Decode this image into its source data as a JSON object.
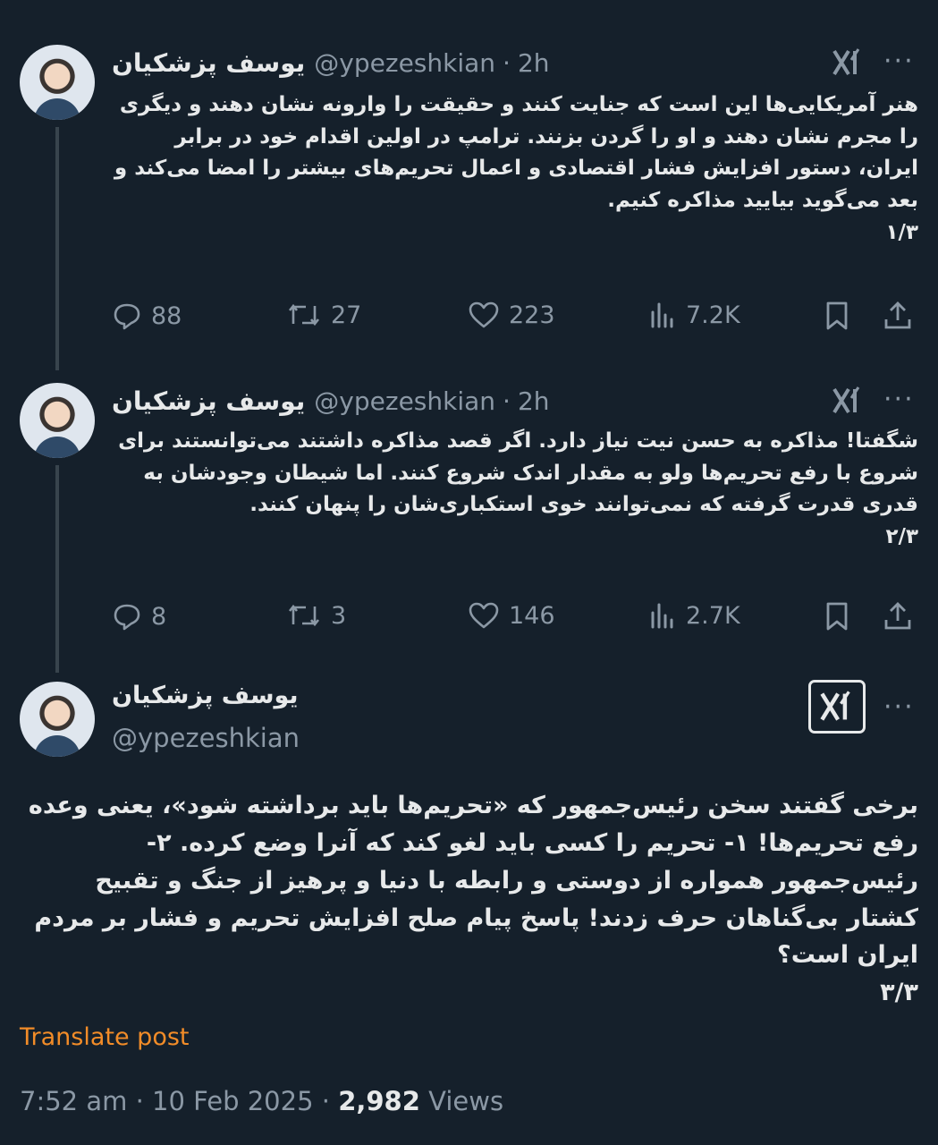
{
  "tweets": [
    {
      "name": "یوسف پزشکیان",
      "handle": "@ypezeshkian",
      "time": "2h",
      "text_lines": [
        "هنر آمریکایی‌ها این است که جنایت کنند و حقیقت  را وارونه نشان دهند و دیگری را مجرم نشان دهند و او را گردن بزنند. ترامپ در اولین اقدام خود در برابر ایران، دستور افزایش فشار اقتصادی و اعمال تحریم‌های بیشتر را امضا می‌کند و بعد می‌گوید بیایید مذاکره کنیم.",
        "۱/۳"
      ],
      "replies": "88",
      "reposts": "27",
      "likes": "223",
      "views": "7.2K"
    },
    {
      "name": "یوسف پزشکیان",
      "handle": "@ypezeshkian",
      "time": "2h",
      "text_lines": [
        "شگفتا! مذاکره به حسن نیت نیاز دارد. اگر قصد مذاکره داشتند می‌توانستند برای شروع با رفع تحریم‌ها ولو به مقدار اندک شروع کنند. اما شیطان وجودشان به قدری قدرت گرفته که نمی‌توانند خوی استکباری‌شان را پنهان کنند.",
        "۲/۳"
      ],
      "replies": "8",
      "reposts": "3",
      "likes": "146",
      "views": "2.7K"
    }
  ],
  "main_tweet": {
    "name": "یوسف پزشکیان",
    "handle": "@ypezeshkian",
    "text_lines": [
      "برخی گفتند سخن رئیس‌جمهور که «تحریم‌ها باید برداشته شود»، یعنی وعده رفع تحریم‌ها! ۱- تحریم را کسی باید لغو کند که آنرا وضع کرده. ۲- رئیس‌جمهور همواره از دوستی و رابطه با دنیا و پرهیز از جنگ و تقبیح کشتار بی‌گناهان حرف زدند! پاسخ پیام صلح افزایش تحریم و فشار بر مردم ایران است؟",
      "۳/۳"
    ],
    "translate_label": "Translate post",
    "timestamp": "7:52 am",
    "date": "10 Feb 2025",
    "views_count": "2,982",
    "views_label": "Views"
  },
  "colors": {
    "background": "#15202b",
    "text": "#e7e9ea",
    "muted": "#8b98a5",
    "accent_translate": "#f28c28"
  },
  "icons": [
    "grok-icon",
    "more-icon",
    "reply-icon",
    "repost-icon",
    "like-icon",
    "views-icon",
    "bookmark-icon",
    "share-icon"
  ]
}
